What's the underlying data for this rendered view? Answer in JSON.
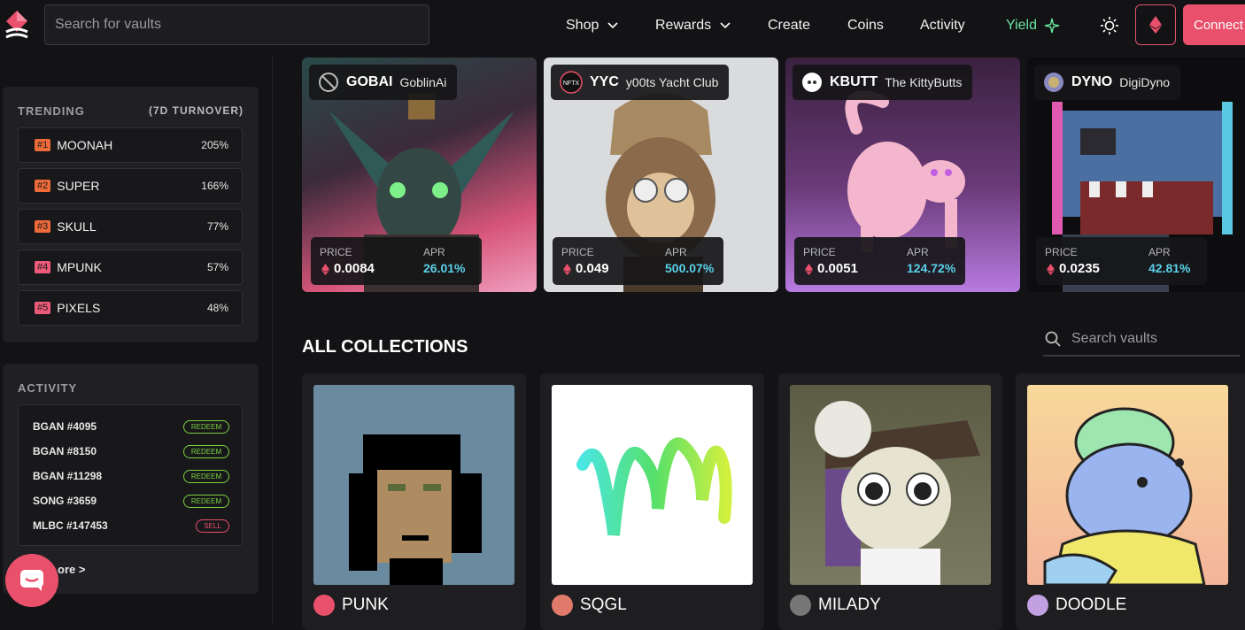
{
  "header": {
    "search_placeholder": "Search for vaults",
    "nav": [
      {
        "label": "Shop",
        "dropdown": true
      },
      {
        "label": "Rewards",
        "dropdown": true
      },
      {
        "label": "Create"
      },
      {
        "label": "Coins"
      },
      {
        "label": "Activity"
      },
      {
        "label": "Yield"
      }
    ],
    "connect_label": "Connect",
    "colors": {
      "accent": "#e9506b",
      "yield": "#6be6a0",
      "background": "#131316"
    }
  },
  "trending": {
    "title": "TRENDING",
    "subtitle": "(7D TURNOVER)",
    "items": [
      {
        "rank": "#1",
        "name": "MOONAH",
        "pct": "205%"
      },
      {
        "rank": "#2",
        "name": "SUPER",
        "pct": "166%"
      },
      {
        "rank": "#3",
        "name": "SKULL",
        "pct": "77%"
      },
      {
        "rank": "#4",
        "name": "MPUNK",
        "pct": "57%"
      },
      {
        "rank": "#5",
        "name": "PIXELS",
        "pct": "48%"
      }
    ]
  },
  "activity": {
    "title": "ACTIVITY",
    "items": [
      {
        "name": "BGAN #4095",
        "badge": "REDEEM"
      },
      {
        "name": "BGAN #8150",
        "badge": "REDEEM"
      },
      {
        "name": "BGAN #11298",
        "badge": "REDEEM"
      },
      {
        "name": "SONG #3659",
        "badge": "REDEEM"
      },
      {
        "name": "MLBC #147453",
        "badge": "SELL"
      }
    ],
    "more_label": "ore >"
  },
  "featured": [
    {
      "symbol": "GOBAI",
      "name": "GoblinAi",
      "price_label": "PRICE",
      "price": "0.0084",
      "apr_label": "APR",
      "apr": "26.01%",
      "apr_color": "#5ad1e8"
    },
    {
      "symbol": "YYC",
      "name": "y00ts Yacht Club",
      "price_label": "PRICE",
      "price": "0.049",
      "apr_label": "APR",
      "apr": "500.07%",
      "apr_color": "#5ad1e8"
    },
    {
      "symbol": "KBUTT",
      "name": "The KittyButts",
      "price_label": "PRICE",
      "price": "0.0051",
      "apr_label": "APR",
      "apr": "124.72%",
      "apr_color": "#5ad1e8"
    },
    {
      "symbol": "DYNO",
      "name": "DigiDyno",
      "price_label": "PRICE",
      "price": "0.0235",
      "apr_label": "APR",
      "apr": "42.81%",
      "apr_color": "#5ad1e8"
    }
  ],
  "collections": {
    "title": "ALL COLLECTIONS",
    "search_placeholder": "Search vaults",
    "items": [
      {
        "label": "PUNK"
      },
      {
        "label": "SQGL"
      },
      {
        "label": "MILADY"
      },
      {
        "label": "DOODLE"
      }
    ]
  }
}
